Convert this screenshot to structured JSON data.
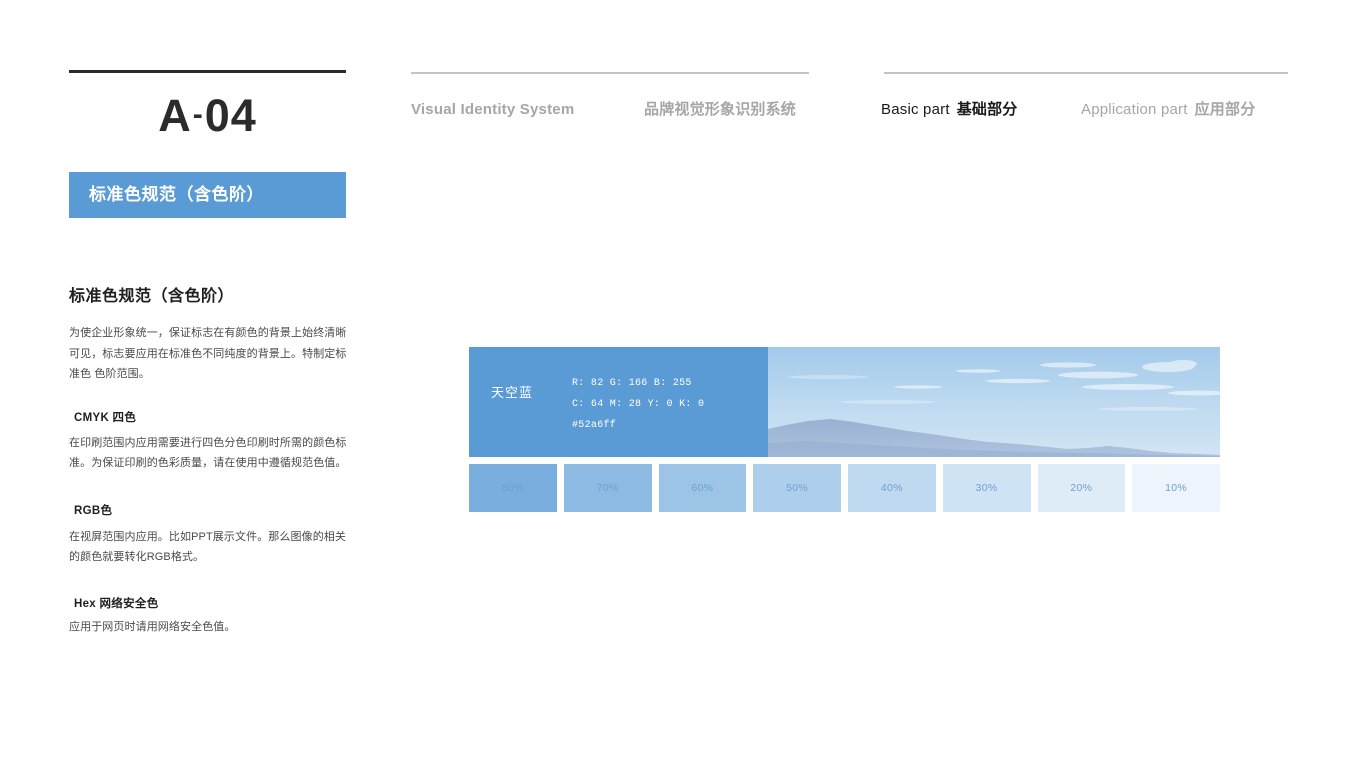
{
  "header": {
    "code": "A",
    "code_dash": "-",
    "code_number": "04",
    "nav": [
      {
        "en": "Visual Identity System",
        "cn": "",
        "active": false
      },
      {
        "en": "",
        "cn": "品牌视觉形象识别系统",
        "active": false
      },
      {
        "en": "Basic part",
        "cn": "基础部分",
        "active": true
      },
      {
        "en": "Application part",
        "cn": "应用部分",
        "active": false
      }
    ],
    "nav_1_en": "Visual Identity System",
    "nav_2_cn": "品牌视觉形象识别系统",
    "nav_3_en": "Basic part",
    "nav_3_cn": "基础部分",
    "nav_4_en": "Application part",
    "nav_4_cn": "应用部分"
  },
  "banner": {
    "label": "标准色规范（含色阶）",
    "bg_color": "#5b9bd5",
    "text_color": "#ffffff"
  },
  "left_column": {
    "section_title": "标准色规范（含色阶）",
    "intro_paragraph": "为使企业形象统一，保证标志在有颜色的背景上始终清晰可见，标志要应用在标准色不同纯度的背景上。特制定标准色 色阶范围。",
    "cmyk_heading": "CMYK 四色",
    "cmyk_paragraph": "在印刷范围内应用需要进行四色分色印刷时所需的颜色标准。为保证印刷的色彩质量，请在使用中遵循规范色值。",
    "rgb_heading": "RGB色",
    "rgb_paragraph": "在视屏范围内应用。比如PPT展示文件。那么图像的相关的颜色就要转化RGB格式。",
    "hex_heading": "Hex 网络安全色",
    "hex_paragraph": "应用于网页时请用网络安全色值。"
  },
  "color_block": {
    "name": "天空蓝",
    "rgb": "R: 82  G: 166 B: 255",
    "cmyk": "C: 64 M: 28 Y: 0 K: 0",
    "hex": "#52a6ff",
    "swatch_color": "#5b9bd5"
  },
  "tints": [
    {
      "label": "80%",
      "color": "#7aaede"
    },
    {
      "label": "70%",
      "color": "#8cbae3"
    },
    {
      "label": "60%",
      "color": "#9cc4e7"
    },
    {
      "label": "50%",
      "color": "#aecfec"
    },
    {
      "label": "40%",
      "color": "#bfd9f0"
    },
    {
      "label": "30%",
      "color": "#cee3f4"
    },
    {
      "label": "20%",
      "color": "#deecf8"
    },
    {
      "label": "10%",
      "color": "#edf4fc"
    }
  ]
}
